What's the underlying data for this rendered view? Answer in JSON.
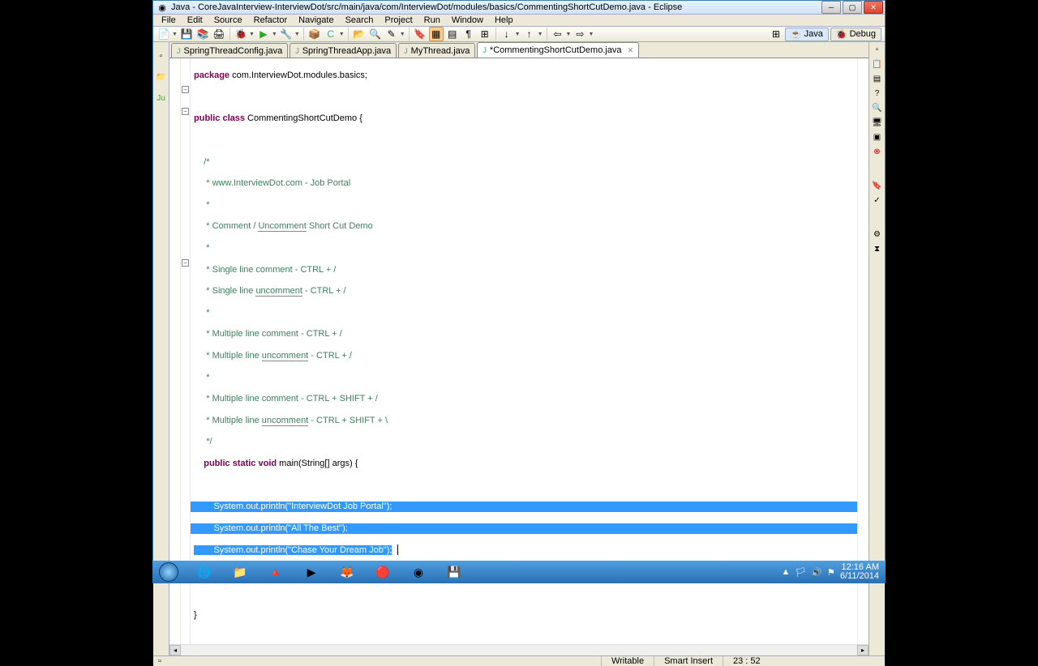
{
  "titlebar": {
    "text": "Java - CoreJavaInterview-InterviewDot/src/main/java/com/InterviewDot/modules/basics/CommentingShortCutDemo.java - Eclipse"
  },
  "menu": [
    "File",
    "Edit",
    "Source",
    "Refactor",
    "Navigate",
    "Search",
    "Project",
    "Run",
    "Window",
    "Help"
  ],
  "perspective": {
    "java": "Java",
    "debug": "Debug"
  },
  "tabs": [
    {
      "label": "SpringThreadConfig.java",
      "active": false
    },
    {
      "label": "SpringThreadApp.java",
      "active": false
    },
    {
      "label": "MyThread.java",
      "active": false
    },
    {
      "label": "*CommentingShortCutDemo.java",
      "active": true
    }
  ],
  "code": {
    "package": "package",
    "packageName": " com.InterviewDot.modules.basics;",
    "public": "public",
    "class": "class",
    "className": " CommentingShortCutDemo {",
    "c1": "    /*",
    "c2": "     * www.InterviewDot.com - Job Portal",
    "c3": "     *",
    "c4a": "     * Comment / ",
    "c4b": "Uncomment",
    "c4c": " Short Cut Demo",
    "c5": "     *",
    "c6": "     * Single line comment - CTRL + /",
    "c7a": "     * Single line ",
    "c7b": "uncomment",
    "c7c": " - CTRL + /",
    "c8": "     *",
    "c9": "     * Multiple line comment - CTRL + /",
    "c10a": "     * Multiple line ",
    "c10b": "uncomment",
    "c10c": " - CTRL + /",
    "c11": "     *",
    "c12": "     * Multiple line comment - CTRL + SHIFT + /",
    "c13a": "     * Multiple line ",
    "c13b": "uncomment",
    "c13c": " - CTRL + SHIFT + \\",
    "c14": "     */",
    "static": "static",
    "void": "void",
    "mainSig": " main(String[] args) {",
    "p1a": "        System.",
    "p1b": "out",
    "p1c": ".println(",
    "s1": "\"InterviewDot Job Portal\"",
    "p1d": ");",
    "p2a": "        System.",
    "p2b": "out",
    "p2c": ".println(",
    "s2": "\"All The Best\"",
    "p2d": ");",
    "p3a": "        System.",
    "p3b": "out",
    "p3c": ".println(",
    "s3": "\"Chase Your Dream Job\"",
    "p3d": ");",
    "close1": "    }",
    "close2": "}"
  },
  "status": {
    "writable": "Writable",
    "insert": "Smart Insert",
    "pos": "23 : 52"
  },
  "tray": {
    "time": "12:16 AM",
    "date": "6/11/2014"
  }
}
